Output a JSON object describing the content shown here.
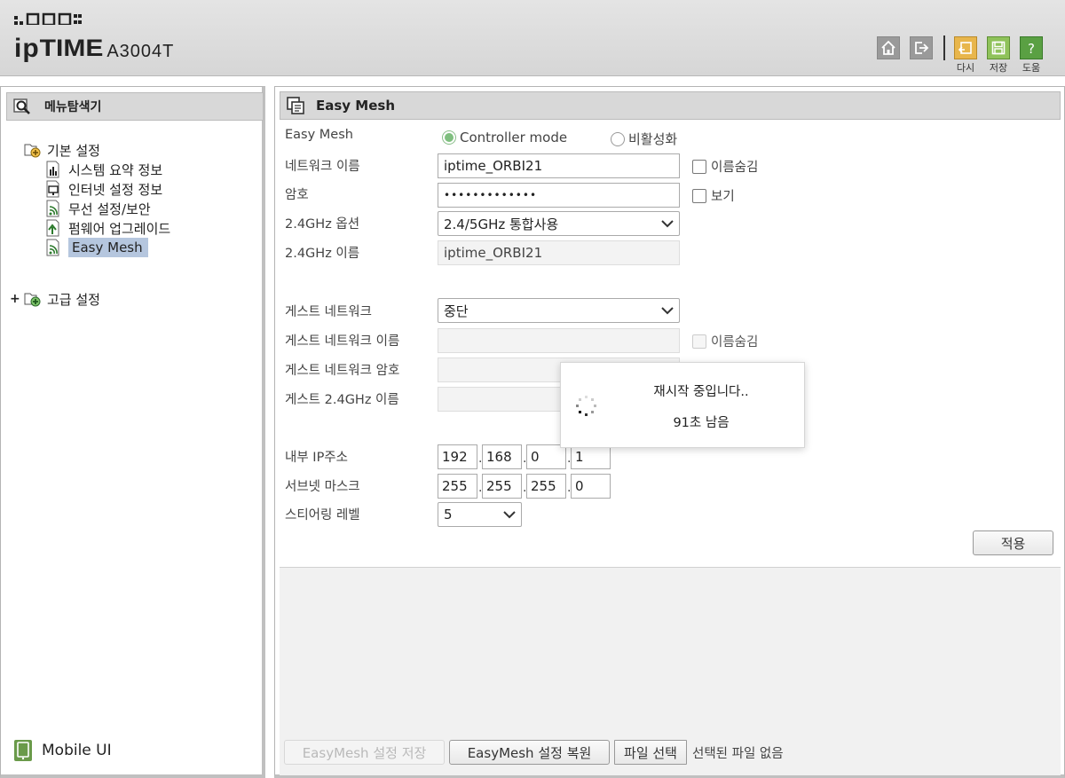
{
  "header": {
    "brand": {
      "prefix": "ip",
      "name": "TIME",
      "model": "A3004T"
    },
    "toolbar": {
      "home_icon": "home-icon",
      "logout_icon": "logout-icon",
      "reset_label": "다시",
      "save_label": "저장",
      "help_label": "도움",
      "colors": {
        "reset": "#e8b64c",
        "save": "#8fc25a",
        "help": "#5aa043"
      }
    }
  },
  "sidebar": {
    "title": "메뉴탐색기",
    "basic": {
      "label": "기본 설정",
      "items": [
        {
          "label": "시스템 요약 정보",
          "icon": "chart-icon"
        },
        {
          "label": "인터넷 설정 정보",
          "icon": "monitor-icon"
        },
        {
          "label": "무선 설정/보안",
          "icon": "wifi-icon"
        },
        {
          "label": "펌웨어 업그레이드",
          "icon": "upgrade-icon"
        },
        {
          "label": "Easy Mesh",
          "icon": "wifi-icon",
          "selected": true
        }
      ]
    },
    "advanced": {
      "expander": "+",
      "label": "고급 설정"
    },
    "mobile_label": "Mobile UI"
  },
  "main": {
    "title": "Easy Mesh",
    "form": {
      "easymesh_label": "Easy Mesh",
      "mode_controller": "Controller mode",
      "mode_disabled": "비활성화",
      "network_name_label": "네트워크 이름",
      "network_name_value": "iptime_ORBI21",
      "hide_name_label": "이름숨김",
      "password_label": "암호",
      "password_value": "•••••••••••••",
      "show_label": "보기",
      "band_option_label": "2.4GHz 옵션",
      "band_option_value": "2.4/5GHz 통합사용",
      "band_name_label": "2.4GHz 이름",
      "band_name_value": "iptime_ORBI21",
      "guest_label": "게스트 네트워크",
      "guest_value": "중단",
      "guest_name_label": "게스트 네트워크 이름",
      "guest_hide_label": "이름숨김",
      "guest_password_label": "게스트 네트워크 암호",
      "guest_band_label": "게스트 2.4GHz 이름",
      "ip_label": "내부 IP주소",
      "ip": [
        "192",
        "168",
        "0",
        "1"
      ],
      "subnet_label": "서브넷 마스크",
      "subnet": [
        "255",
        "255",
        "255",
        "0"
      ],
      "steering_label": "스티어링 레벨",
      "steering_value": "5",
      "apply_label": "적용"
    },
    "footer": {
      "save_config_label": "EasyMesh 설정 저장",
      "restore_config_label": "EasyMesh 설정 복원",
      "choose_file_label": "파일 선택",
      "no_file_label": "선택된 파일 없음"
    }
  },
  "modal": {
    "message": "재시작 중입니다..",
    "countdown": "91초 남음"
  }
}
